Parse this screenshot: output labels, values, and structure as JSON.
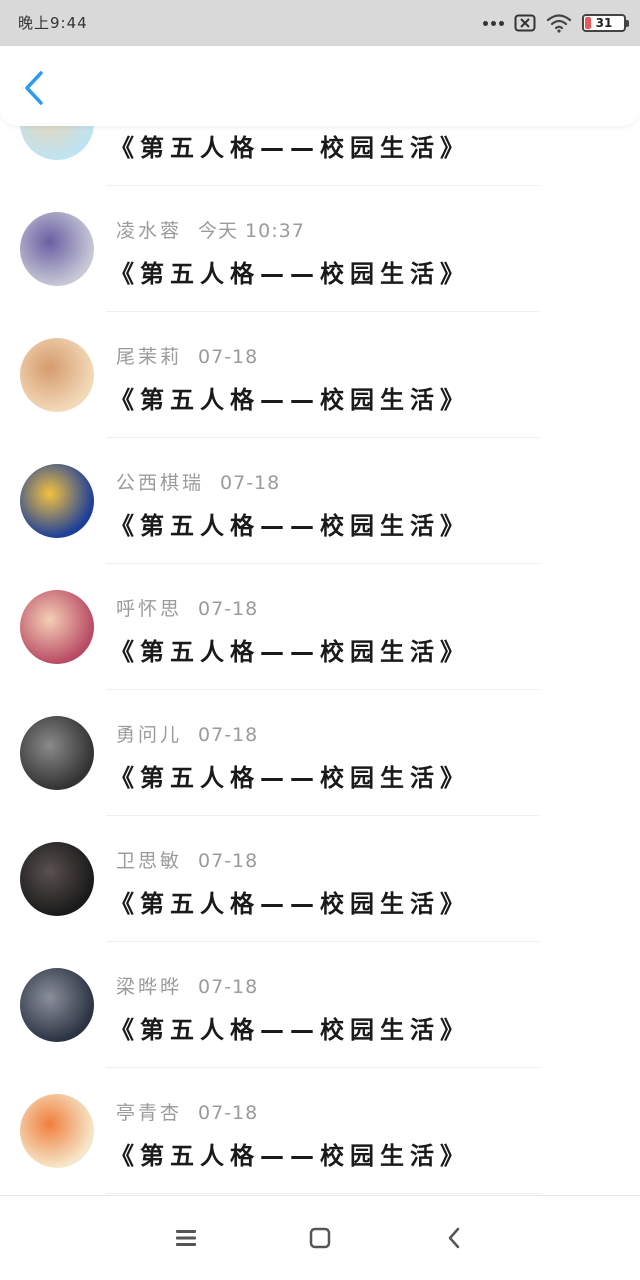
{
  "status_bar": {
    "time": "晚上9:44",
    "battery": "31",
    "icons": [
      "more-dots-icon",
      "close-box-icon",
      "wifi-icon",
      "battery-icon"
    ]
  },
  "header": {
    "back_icon": "chevron-left-icon",
    "accent_color": "#2d9bf0"
  },
  "messages": [
    {
      "name": "",
      "time": "",
      "text": "《第五人格——校园生活》",
      "avatar_colors": [
        "#bfe3f2",
        "#e9d6b8"
      ]
    },
    {
      "name": "凌水蓉",
      "time": "今天 10:37",
      "text": "《第五人格——校园生活》",
      "avatar_colors": [
        "#c7c7d6",
        "#6a5fa3"
      ]
    },
    {
      "name": "尾茉莉",
      "time": "07-18",
      "text": "《第五人格——校园生活》",
      "avatar_colors": [
        "#f3d9b8",
        "#d59b6e"
      ]
    },
    {
      "name": "公西棋瑞",
      "time": "07-18",
      "text": "《第五人格——校园生活》",
      "avatar_colors": [
        "#1d3f9a",
        "#f2c240"
      ]
    },
    {
      "name": "呼怀思",
      "time": "07-18",
      "text": "《第五人格——校园生活》",
      "avatar_colors": [
        "#b84c64",
        "#f6cfb6"
      ]
    },
    {
      "name": "勇问儿",
      "time": "07-18",
      "text": "《第五人格——校园生活》",
      "avatar_colors": [
        "#333333",
        "#8a8a8a"
      ]
    },
    {
      "name": "卫思敏",
      "time": "07-18",
      "text": "《第五人格——校园生活》",
      "avatar_colors": [
        "#1a1a1a",
        "#5a5050"
      ]
    },
    {
      "name": "梁晔晔",
      "time": "07-18",
      "text": "《第五人格——校园生活》",
      "avatar_colors": [
        "#2c3444",
        "#8a8f99"
      ]
    },
    {
      "name": "亭青杏",
      "time": "07-18",
      "text": "《第五人格——校园生活》",
      "avatar_colors": [
        "#f6e6c9",
        "#f07e3c"
      ]
    }
  ],
  "nav_bar": {
    "icons": [
      "menu-icon",
      "home-square-icon",
      "back-chevron-icon"
    ]
  }
}
